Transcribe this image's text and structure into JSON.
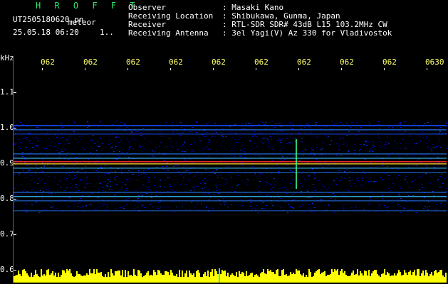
{
  "header": {
    "brand": "H R O F F T",
    "filename": "UT2505180620.pn",
    "meteor_label": "meteor",
    "datetime": "25.05.18 06:20",
    "aux": "1.."
  },
  "info": {
    "observer_label": "Observer",
    "observer_value": ": Masaki Kano",
    "location_label": "Receiving Location",
    "location_value": ": Shibukawa, Gunma, Japan",
    "receiver_label": "Receiver",
    "receiver_value": ": RTL-SDR SDR# 43dB L15 103.2MHz CW",
    "antenna_label": "Receiving Antenna",
    "antenna_value": ": 3el Yagi(V) Az 330 for Vladivostok"
  },
  "axis": {
    "unit": "kHz",
    "y_ticks": [
      "1.1",
      "1.0",
      "0.9",
      "0.8",
      "0.7",
      "0.6"
    ],
    "x_ticks": [
      "062",
      "062",
      "062",
      "062",
      "062",
      "062",
      "062",
      "062",
      "062",
      "0630"
    ]
  },
  "colors": {
    "brand": "#2fe26b",
    "time_ticks": "#ffff66",
    "spectrum": "#ffff00",
    "hot_line": "#ff2a2a",
    "background": "#000000"
  }
}
